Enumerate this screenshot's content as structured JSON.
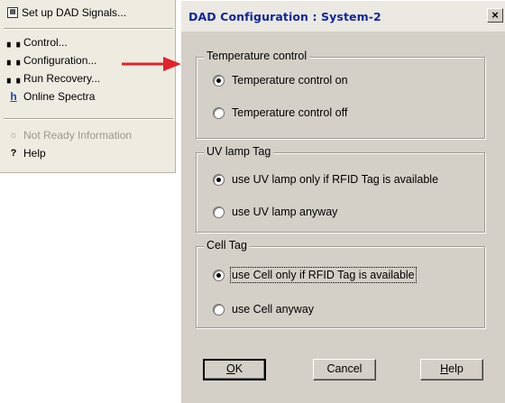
{
  "menu": {
    "items": [
      {
        "label": "Set up DAD Signals...",
        "icon": "signals-icon",
        "enabled": true
      },
      {
        "label": "Control...",
        "icon": "control-icon",
        "enabled": true
      },
      {
        "label": "Configuration...",
        "icon": "configuration-icon",
        "enabled": true
      },
      {
        "label": "Run Recovery...",
        "icon": "run-recovery-icon",
        "enabled": true
      },
      {
        "label": "Online Spectra",
        "icon": "online-spectra-icon",
        "enabled": true
      },
      {
        "label": "Not Ready Information",
        "icon": "not-ready-icon",
        "enabled": false
      },
      {
        "label": "Help",
        "icon": "help-icon",
        "enabled": true
      }
    ]
  },
  "arrow_color": "#e0242c",
  "dialog": {
    "title": "DAD Configuration : System-2",
    "close_glyph": "×",
    "title_color": "#10269b",
    "groups": {
      "temperature": {
        "label": "Temperature control",
        "options": [
          "Temperature control on",
          "Temperature control off"
        ],
        "selected": 0
      },
      "uv_lamp": {
        "label": "UV lamp Tag",
        "options": [
          "use UV lamp only if RFID Tag is available",
          "use UV lamp anyway"
        ],
        "selected": 0
      },
      "cell": {
        "label": "Cell Tag",
        "options": [
          "use Cell only if RFID Tag is available",
          "use Cell anyway"
        ],
        "selected": 0
      }
    },
    "buttons": {
      "ok": {
        "first": "O",
        "rest": "K"
      },
      "cancel": "Cancel",
      "help": {
        "first": "H",
        "rest": "elp"
      }
    }
  }
}
